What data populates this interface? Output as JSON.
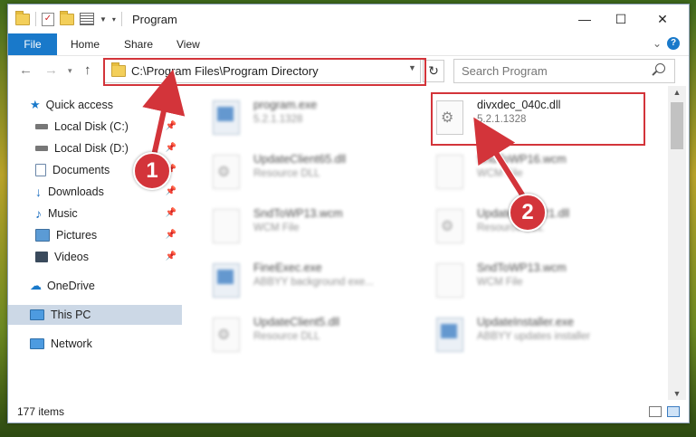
{
  "window": {
    "title": "Program",
    "controls": {
      "minimize": "—",
      "maximize": "☐",
      "close": "✕"
    }
  },
  "ribbon": {
    "tabs": [
      {
        "label": "File"
      },
      {
        "label": "Home"
      },
      {
        "label": "Share"
      },
      {
        "label": "View"
      }
    ],
    "help_label": "?"
  },
  "address_bar": {
    "path": "C:\\Program Files\\Program Directory",
    "search_placeholder": "Search Program"
  },
  "sidebar": {
    "items": [
      {
        "label": "Quick access",
        "icon": "star-icon"
      },
      {
        "label": "Local Disk (C:)",
        "icon": "drive-icon",
        "pinned": true
      },
      {
        "label": "Local Disk (D:)",
        "icon": "drive-icon",
        "pinned": true
      },
      {
        "label": "Documents",
        "icon": "document-icon",
        "pinned": true
      },
      {
        "label": "Downloads",
        "icon": "download-icon",
        "pinned": true
      },
      {
        "label": "Music",
        "icon": "music-icon",
        "pinned": true
      },
      {
        "label": "Pictures",
        "icon": "pictures-icon",
        "pinned": true
      },
      {
        "label": "Videos",
        "icon": "videos-icon",
        "pinned": true
      },
      {
        "label": "OneDrive",
        "icon": "cloud-icon"
      },
      {
        "label": "This PC",
        "icon": "computer-icon",
        "selected": true
      },
      {
        "label": "Network",
        "icon": "network-icon"
      }
    ]
  },
  "files": [
    {
      "name": "program.exe",
      "desc": "5.2.1.1328",
      "type": "exe",
      "blurred": true
    },
    {
      "name": "divxdec_040c.dll",
      "desc": "5.2.1.1328",
      "type": "dll",
      "blurred": false
    },
    {
      "name": "UpdateClient65.dll",
      "desc": "Resource DLL",
      "type": "dll",
      "blurred": true
    },
    {
      "name": "SndToWP16.wcm",
      "desc": "WCM File",
      "type": "file",
      "blurred": true
    },
    {
      "name": "SndToWP13.wcm",
      "desc": "WCM File",
      "type": "file",
      "blurred": true
    },
    {
      "name": "UpdateClient21.dll",
      "desc": "Resource DLL",
      "type": "dll",
      "blurred": true
    },
    {
      "name": "FineExec.exe",
      "desc": "ABBYY background exe...",
      "type": "exe",
      "blurred": true
    },
    {
      "name": "SndToWP13.wcm",
      "desc": "WCM File",
      "type": "file",
      "blurred": true
    },
    {
      "name": "UpdateClient5.dll",
      "desc": "Resource DLL",
      "type": "dll",
      "blurred": true
    },
    {
      "name": "UpdateInstaller.exe",
      "desc": "ABBYY updates installer",
      "type": "exe",
      "blurred": true
    }
  ],
  "status": {
    "items_count": "177 items"
  },
  "annotations": [
    {
      "number": "1"
    },
    {
      "number": "2"
    }
  ],
  "colors": {
    "accent": "#1979ca",
    "highlight_red": "#d3343a"
  }
}
